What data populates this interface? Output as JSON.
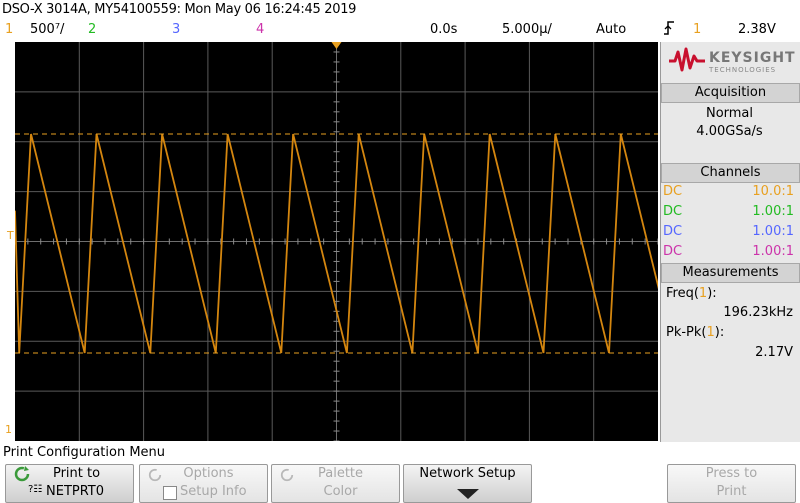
{
  "header": {
    "title": "DSO-X 3014A, MY54100559: Mon May 06 16:24:45 2019",
    "ch1_num": "1",
    "ch1_scale": "500⁷/",
    "ch2_num": "2",
    "ch3_num": "3",
    "ch4_num": "4",
    "time_delay": "0.0s",
    "time_scale": "5.000µ/",
    "trigger_mode": "Auto",
    "trigger_slope_icon": "trigger-rising-edge-icon",
    "trigger_source": "1",
    "trigger_level": "2.38V"
  },
  "colors": {
    "ch1": "#e8a020",
    "ch2": "#22bb22",
    "ch3": "#5566ff",
    "ch4": "#cc33aa",
    "trace": "#d4860f",
    "keysight_red": "#c8102e"
  },
  "brand": {
    "name": "KEYSIGHT",
    "sub": "TECHNOLOGIES"
  },
  "acquisition": {
    "title": "Acquisition",
    "mode": "Normal",
    "rate": "4.00GSa/s"
  },
  "channels": {
    "title": "Channels",
    "rows": [
      {
        "coupling": "DC",
        "probe": "10.0:1"
      },
      {
        "coupling": "DC",
        "probe": "1.00:1"
      },
      {
        "coupling": "DC",
        "probe": "1.00:1"
      },
      {
        "coupling": "DC",
        "probe": "1.00:1"
      }
    ]
  },
  "measurements": {
    "title": "Measurements",
    "freq_label_pre": "Freq(",
    "freq_label_ch": "1",
    "freq_label_post": "):",
    "freq_value": "196.23kHz",
    "pkpk_label_pre": "Pk-Pk(",
    "pkpk_label_ch": "1",
    "pkpk_label_post": "):",
    "pkpk_value": "2.17V"
  },
  "markers": {
    "ground": "1",
    "trigger_level": "T"
  },
  "waveform": {
    "type": "triangle",
    "frequency_khz": 196.23,
    "peak_to_peak_v": 2.17
  },
  "menu": {
    "title": "Print Configuration Menu",
    "softkeys": [
      {
        "line1": "Print to",
        "line2": "NETPRT0",
        "enabled": true
      },
      {
        "line1": "Options",
        "line2": "Setup Info",
        "enabled": false
      },
      {
        "line1": "Palette",
        "line2": "Color",
        "enabled": false
      },
      {
        "line1": "Network Setup",
        "line2": "",
        "enabled": true
      },
      {
        "line1": "Press to",
        "line2": "Print",
        "enabled": false
      }
    ]
  }
}
